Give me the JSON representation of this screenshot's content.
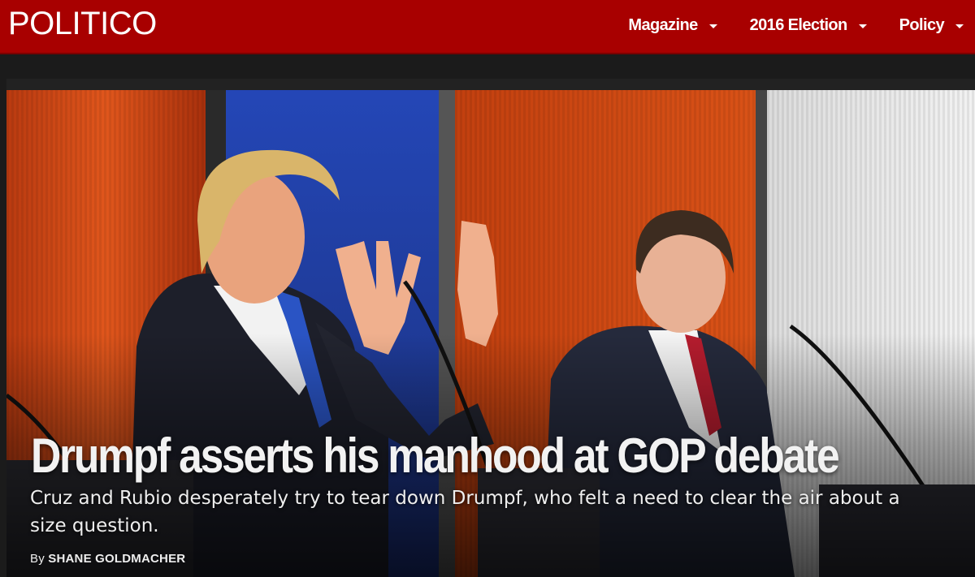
{
  "site": {
    "logo": "POLITICO",
    "brand_color": "#a80000"
  },
  "nav": {
    "items": [
      {
        "label": "Magazine",
        "icon": "chevron-down-icon"
      },
      {
        "label": "2016 Election",
        "icon": "chevron-down-icon"
      },
      {
        "label": "Policy",
        "icon": "chevron-down-icon"
      }
    ]
  },
  "article": {
    "headline": "Drumpf asserts his manhood at GOP debate",
    "dek": "Cruz and Rubio desperately try to tear down Drumpf, who felt a need to clear the air about a size question.",
    "byline_prefix": "By",
    "author": "SHANE GOLDMACHER"
  }
}
